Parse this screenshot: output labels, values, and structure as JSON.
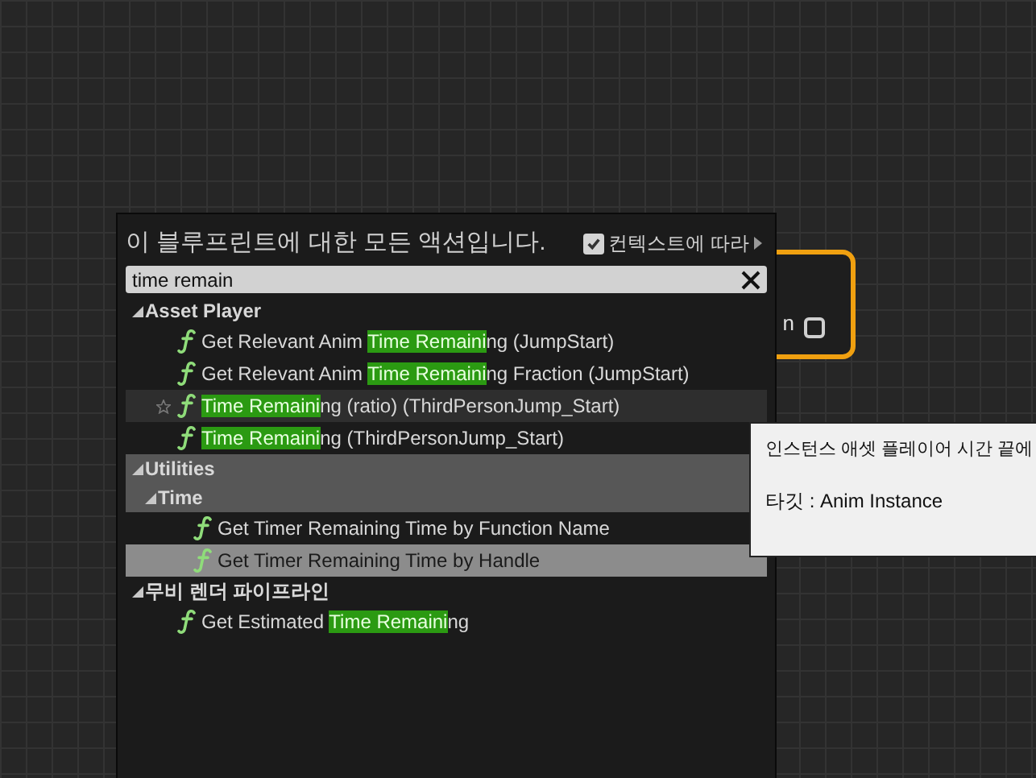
{
  "node": {
    "pin_label": "n"
  },
  "action_menu": {
    "title": "이 블루프린트에 대한 모든 액션입니다.",
    "context": {
      "label": "컨텍스트에 따라",
      "checked": true
    },
    "search": {
      "value": "time remain"
    },
    "tree": [
      {
        "kind": "category",
        "label": "Asset Player",
        "expanded": true,
        "shaded": false,
        "children": [
          {
            "kind": "function",
            "selected": false,
            "hovered": false,
            "before": "Get Relevant Anim ",
            "match": "Time Remaini",
            "after": "ng (JumpStart)"
          },
          {
            "kind": "function",
            "selected": false,
            "hovered": false,
            "before": "Get Relevant Anim ",
            "match": "Time Remaini",
            "after": "ng Fraction (JumpStart)"
          },
          {
            "kind": "function",
            "selected": false,
            "hovered": true,
            "match": "Time Remaini",
            "after": "ng (ratio) (ThirdPersonJump_Start)"
          },
          {
            "kind": "function",
            "selected": false,
            "hovered": false,
            "match": "Time Remaini",
            "after": "ng (ThirdPersonJump_Start)"
          }
        ]
      },
      {
        "kind": "category",
        "label": "Utilities",
        "expanded": true,
        "shaded": true,
        "children": [
          {
            "kind": "category",
            "label": "Time",
            "expanded": true,
            "shaded": true,
            "children": [
              {
                "kind": "function",
                "selected": false,
                "hovered": false,
                "before": "Get Timer Remaining Time by Function Name"
              },
              {
                "kind": "function",
                "selected": true,
                "hovered": false,
                "before": "Get Timer Remaining Time by Handle"
              }
            ]
          }
        ]
      },
      {
        "kind": "category",
        "label": "무비 렌더 파이프라인",
        "expanded": true,
        "shaded": false,
        "children": [
          {
            "kind": "function",
            "selected": false,
            "hovered": false,
            "before": "Get Estimated ",
            "match": "Time Remaini",
            "after": "ng"
          }
        ]
      }
    ]
  },
  "tooltip": {
    "description": "인스턴스 애셋 플레이어 시간 끝에",
    "target": "타깃 : Anim Instance"
  }
}
